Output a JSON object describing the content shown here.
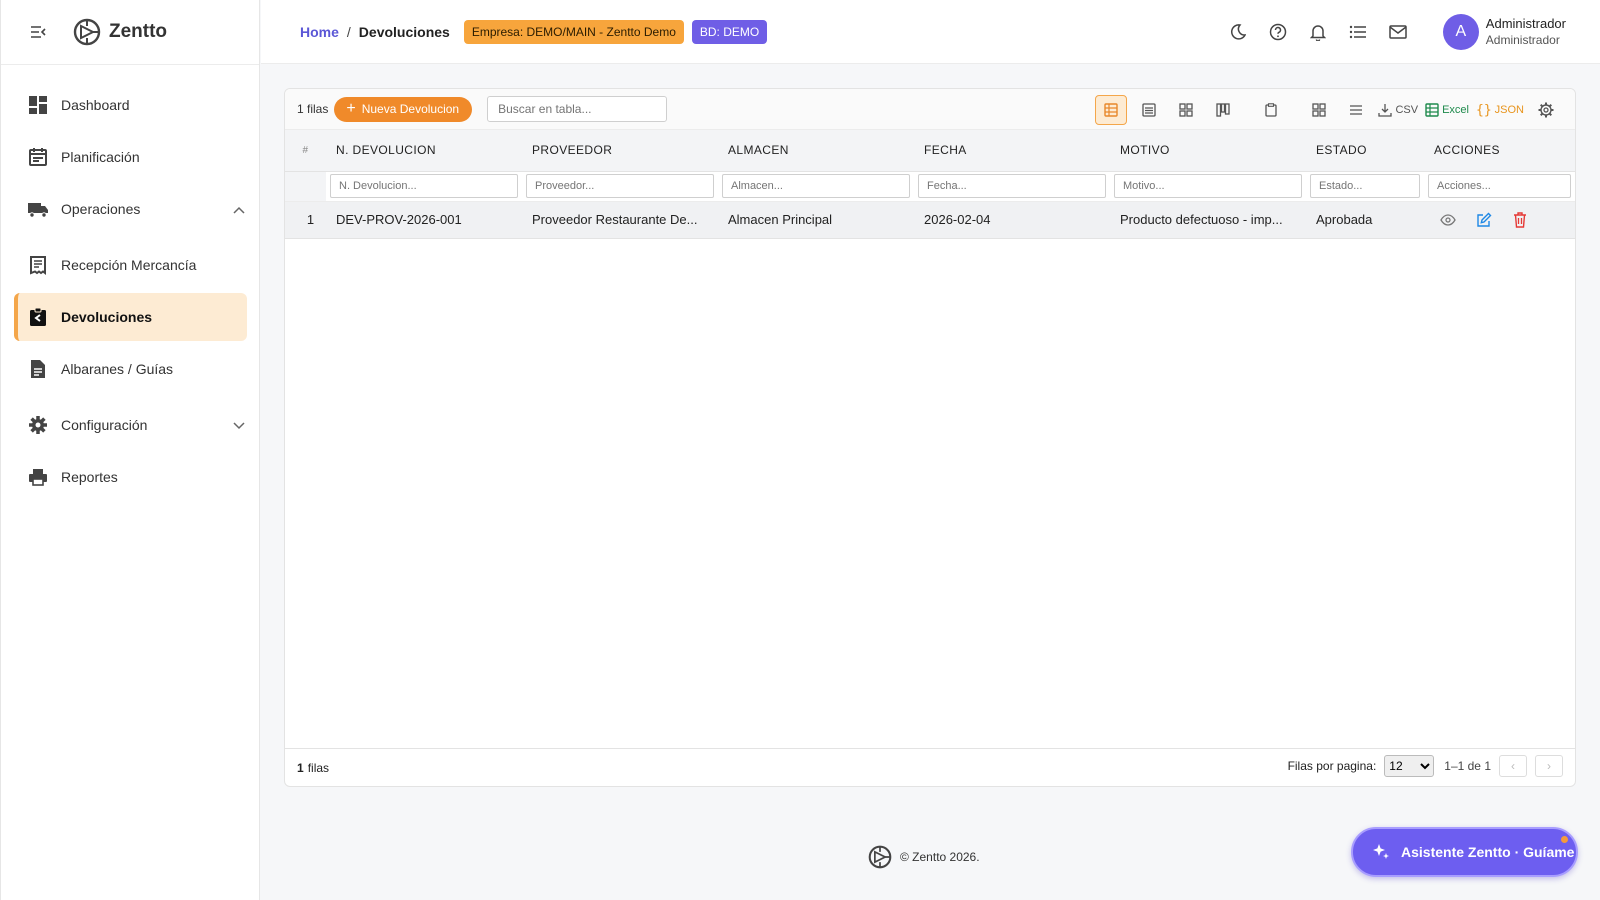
{
  "app": {
    "brand": "Zentto"
  },
  "sidebar": {
    "items": [
      {
        "label": "Dashboard"
      },
      {
        "label": "Planificación"
      },
      {
        "label": "Operaciones"
      },
      {
        "label": "Recepción Mercancía"
      },
      {
        "label": "Devoluciones"
      },
      {
        "label": "Albaranes / Guías"
      },
      {
        "label": "Configuración"
      },
      {
        "label": "Reportes"
      }
    ],
    "active": "Devoluciones"
  },
  "header": {
    "breadcrumb_home": "Home",
    "breadcrumb_sep": "/",
    "breadcrumb_current": "Devoluciones",
    "empresa_chip": "Empresa: DEMO/MAIN - Zentto Demo",
    "bd_chip": "BD: DEMO",
    "user_initial": "A",
    "user_name": "Administrador",
    "user_role": "Administrador"
  },
  "toolbar": {
    "rows_count": "1 filas",
    "new_button": "Nueva Devolucion",
    "search_placeholder": "Buscar en tabla...",
    "csv_label": "CSV",
    "excel_label": "Excel",
    "json_label": "JSON"
  },
  "table": {
    "index_header": "#",
    "columns": [
      "N. DEVOLUCION",
      "PROVEEDOR",
      "ALMACEN",
      "FECHA",
      "MOTIVO",
      "ESTADO",
      "ACCIONES"
    ],
    "filter_placeholders": [
      "N. Devolucion...",
      "Proveedor...",
      "Almacen...",
      "Fecha...",
      "Motivo...",
      "Estado...",
      "Acciones..."
    ],
    "rows": [
      {
        "index": "1",
        "numero": "DEV-PROV-2026-001",
        "proveedor": "Proveedor Restaurante De...",
        "almacen": "Almacen Principal",
        "fecha": "2026-02-04",
        "motivo": "Producto defectuoso - imp...",
        "estado": "Aprobada"
      }
    ]
  },
  "footer": {
    "rows_count_num": "1",
    "rows_count_word": "filas",
    "per_page_label": "Filas por pagina:",
    "per_page_value": "12",
    "range": "1–1 de 1",
    "prev": "‹",
    "next": "›"
  },
  "page_footer": {
    "copyright": "© Zentto 2026."
  },
  "assistant": {
    "label": "Asistente Zentto · Guíame"
  },
  "colors": {
    "accent_orange": "#f08a2a",
    "accent_purple": "#6f5ee6",
    "active_nav_bg": "#fdebd3",
    "delete_red": "#e53935",
    "edit_blue": "#1e88e5"
  },
  "icons": {
    "sidebar": [
      "dashboard-icon",
      "calendar-icon",
      "truck-icon",
      "receipt-icon",
      "return-icon",
      "document-icon",
      "gear-icon",
      "printer-icon"
    ],
    "header": [
      "moon-icon",
      "help-icon",
      "bell-icon",
      "list-icon",
      "mail-icon"
    ],
    "actions": [
      "eye-icon",
      "edit-icon",
      "trash-icon"
    ]
  }
}
